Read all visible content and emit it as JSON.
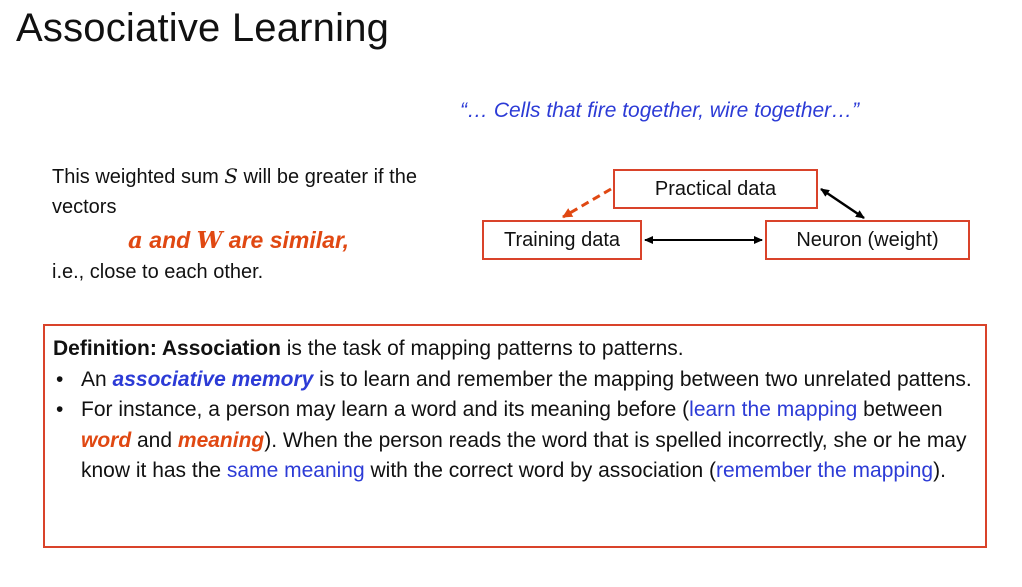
{
  "slide": {
    "title": "Associative Learning",
    "quote": "“… Cells that fire together, wire together…”"
  },
  "explanation": {
    "line1_a": "This weighted sum ",
    "var_s": "S",
    "line1_b": " will be greater if the vectors",
    "var_a": "a",
    "and": " and ",
    "var_w": "W",
    "similar_tail": " are similar,",
    "line3": "i.e., close to each other."
  },
  "diagram": {
    "practical": "Practical data",
    "training": "Training data",
    "neuron": "Neuron (weight)",
    "colors": {
      "box_border": "#d9432a",
      "dashed_arrow": "#e04812",
      "arrow": "#000000"
    }
  },
  "definition": {
    "label": "Definition: Association",
    "text": " is the task of mapping patterns to patterns.",
    "bullet1": {
      "pre": "An ",
      "term": "associative memory",
      "post": " is to learn and remember the mapping between two unrelated pattens."
    },
    "bullet2": {
      "t1": "For instance, a person may learn a word and its meaning before (",
      "l1": "learn the mapping",
      "t2": " between ",
      "w1": "word",
      "t3": " and ",
      "w2": "meaning",
      "t4": "). When the person reads the word that is spelled incorrectly, she or he may know it has the ",
      "l2": "same meaning",
      "t5": " with the correct word by association (",
      "l3": "remember the mapping",
      "t6": ")."
    }
  },
  "colors": {
    "accent_red": "#e04812",
    "link_blue": "#2c3bd6",
    "border_red": "#d9432a"
  }
}
